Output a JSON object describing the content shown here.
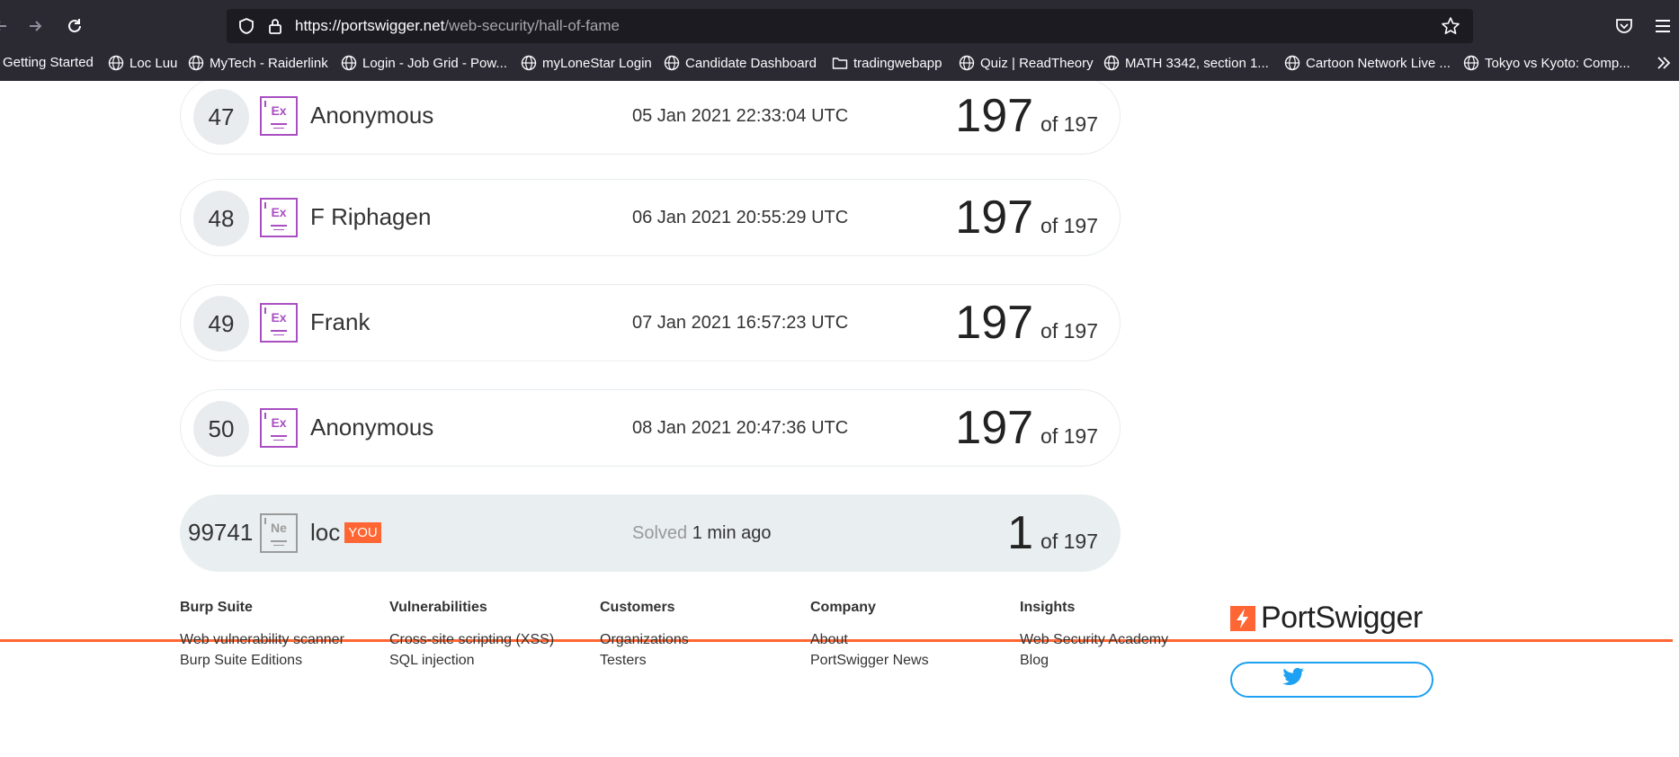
{
  "browser": {
    "url_host": "https://portswigger.net",
    "url_path": "/web-security/hall-of-fame",
    "bookmarks": [
      "Getting Started",
      "Loc Luu",
      "MyTech - Raiderlink",
      "Login - Job Grid - Pow...",
      "myLoneStar Login",
      "Candidate Dashboard",
      "tradingwebapp",
      "Quiz | ReadTheory",
      "MATH 3342, section 1...",
      "Cartoon Network Live ...",
      "Tokyo vs Kyoto: Comp..."
    ]
  },
  "leaderboard": {
    "rows": [
      {
        "rank": "47",
        "badge": "Ex",
        "name": "Anonymous",
        "date": "05 Jan 2021 22:33:04 UTC",
        "score": "197",
        "of": "of 197"
      },
      {
        "rank": "48",
        "badge": "Ex",
        "name": "F Riphagen",
        "date": "06 Jan 2021 20:55:29 UTC",
        "score": "197",
        "of": "of 197"
      },
      {
        "rank": "49",
        "badge": "Ex",
        "name": "Frank",
        "date": "07 Jan 2021 16:57:23 UTC",
        "score": "197",
        "of": "of 197"
      },
      {
        "rank": "50",
        "badge": "Ex",
        "name": "Anonymous",
        "date": "08 Jan 2021 20:47:36 UTC",
        "score": "197",
        "of": "of 197"
      }
    ],
    "you_row": {
      "rank": "99741",
      "badge": "Ne",
      "name": "loc",
      "you_tag": "YOU",
      "solved_label": "Solved",
      "solved_time": "1 min ago",
      "score": "1",
      "of": "of 197"
    }
  },
  "footer": {
    "columns": [
      {
        "heading": "Burp Suite",
        "links": [
          "Web vulnerability scanner",
          "Burp Suite Editions"
        ]
      },
      {
        "heading": "Vulnerabilities",
        "links": [
          "Cross-site scripting (XSS)",
          "SQL injection"
        ]
      },
      {
        "heading": "Customers",
        "links": [
          "Organizations",
          "Testers"
        ]
      },
      {
        "heading": "Company",
        "links": [
          "About",
          "PortSwigger News"
        ]
      },
      {
        "heading": "Insights",
        "links": [
          "Web Security Academy",
          "Blog"
        ]
      }
    ],
    "brand": "PortSwigger"
  },
  "colors": {
    "accent": "#ff6633",
    "expert_badge": "#a94fc2",
    "chrome_bg": "#2b2a33"
  },
  "icons": [
    "back-icon",
    "forward-icon",
    "reload-icon",
    "shield-icon",
    "lock-icon",
    "star-icon",
    "pocket-icon",
    "menu-icon",
    "globe-icon",
    "folder-icon",
    "chevron-double-right-icon",
    "twitter-icon"
  ]
}
